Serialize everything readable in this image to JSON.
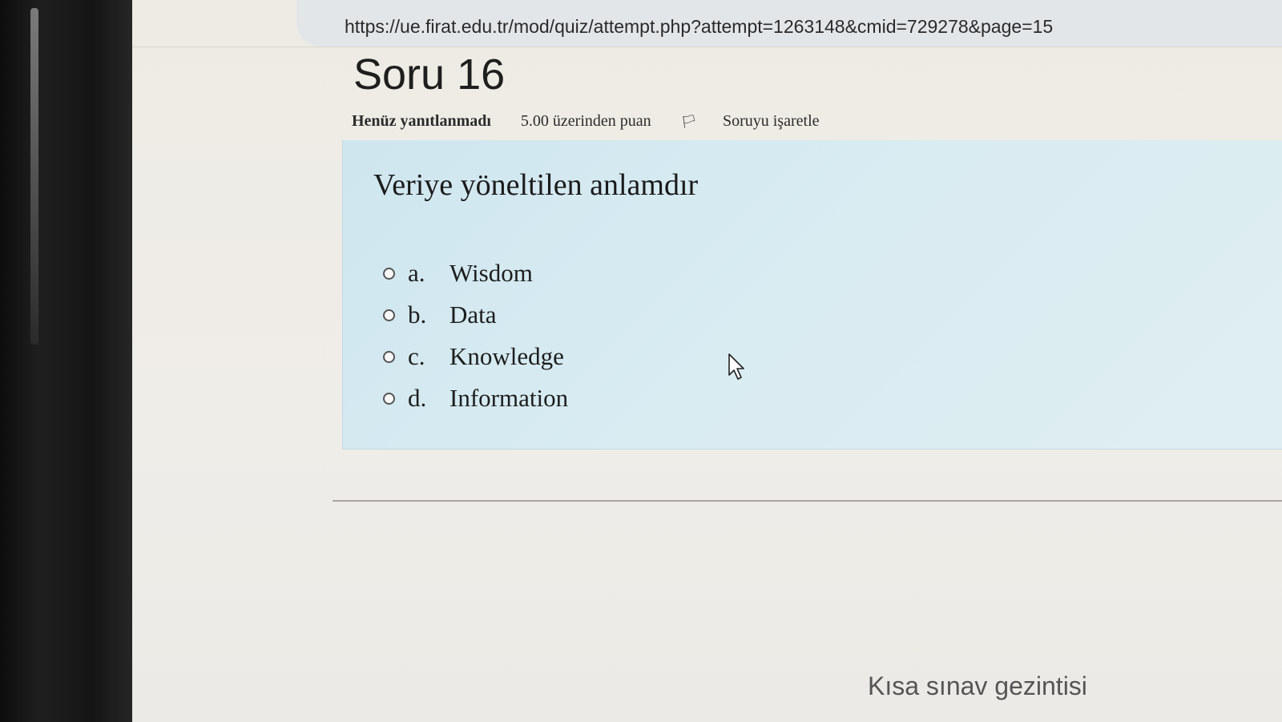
{
  "browser": {
    "url": "https://ue.firat.edu.tr/mod/quiz/attempt.php?attempt=1263148&cmid=729278&page=15"
  },
  "question": {
    "title": "Soru 16",
    "status": "Henüz yanıtlanmadı",
    "points": "5.00 üzerinden puan",
    "flag_label": "Soruyu işaretle",
    "text": "Veriye yöneltilen anlamdır",
    "answers": [
      {
        "letter": "a.",
        "label": "Wisdom"
      },
      {
        "letter": "b.",
        "label": "Data"
      },
      {
        "letter": "c.",
        "label": "Knowledge"
      },
      {
        "letter": "d.",
        "label": "Information"
      }
    ]
  },
  "sidebar": {
    "nav_title": "Kısa sınav gezintisi"
  },
  "icons": {
    "flag": "flag-icon",
    "radio": "radio-icon",
    "cursor": "mouse-cursor-icon"
  }
}
